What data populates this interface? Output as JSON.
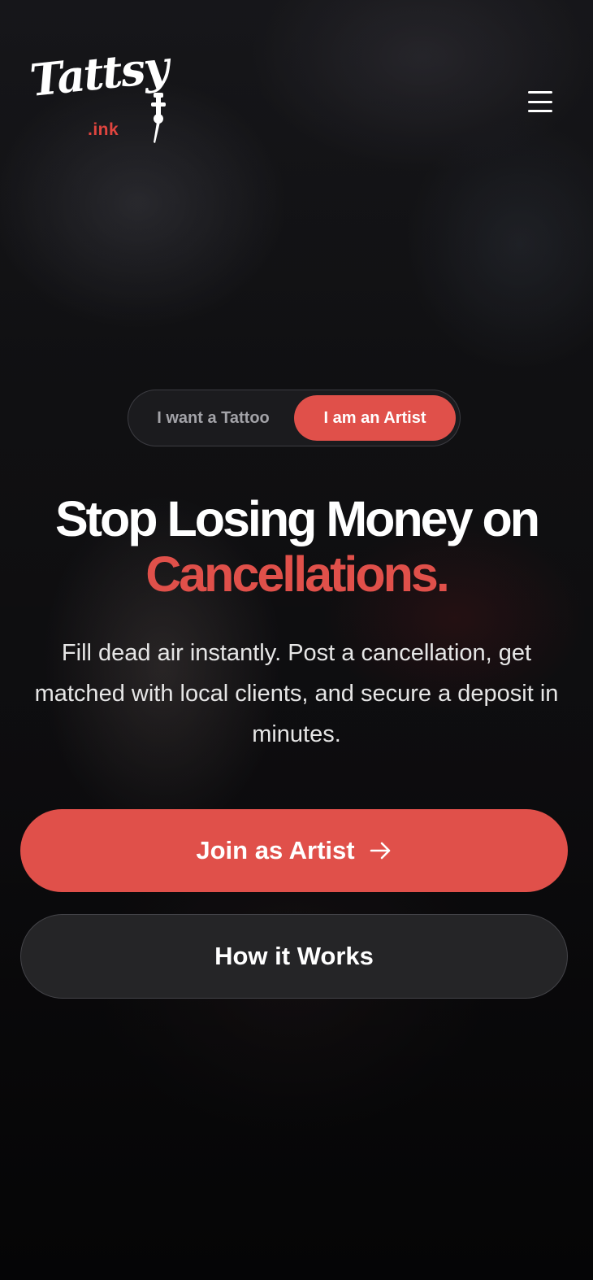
{
  "header": {
    "logo_word": "Tattsy",
    "logo_suffix": ".ink",
    "menu_icon": "hamburger-menu-icon"
  },
  "toggle": {
    "options": [
      {
        "label": "I want a Tattoo",
        "selected": false
      },
      {
        "label": "I am an Artist",
        "selected": true
      }
    ]
  },
  "hero": {
    "headline_line1": "Stop Losing Money on",
    "headline_line2": "Cancellations.",
    "subtext": "Fill dead air instantly. Post a cancellation, get matched with local clients, and secure a deposit in minutes."
  },
  "cta": {
    "primary_label": "Join as Artist",
    "primary_icon": "arrow-right-icon",
    "secondary_label": "How it Works"
  },
  "colors": {
    "accent": "#e0504a",
    "background": "#0b0b0d",
    "text": "#ffffff"
  }
}
